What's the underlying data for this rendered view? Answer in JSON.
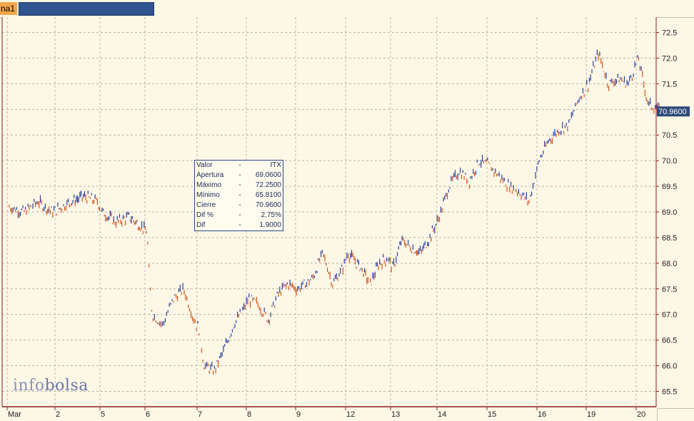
{
  "header": {
    "tab_label": "na1"
  },
  "tooltip": {
    "rows": [
      {
        "label": "Valor",
        "dash": "-",
        "value": "ITX"
      },
      {
        "label": "Apertura",
        "dash": "-",
        "value": "69.0600"
      },
      {
        "label": "Máximo",
        "dash": "-",
        "value": "72.2500"
      },
      {
        "label": "Mínimo",
        "dash": "-",
        "value": "65.8100"
      },
      {
        "label": "Cierre",
        "dash": "-",
        "value": "70.9600"
      },
      {
        "label": "Dif %",
        "dash": "-",
        "value": "2.75%"
      },
      {
        "label": "Dif",
        "dash": "-",
        "value": "1.9000"
      }
    ]
  },
  "watermark": {
    "part1": "info",
    "part2": "bolsa"
  },
  "colors": {
    "background": "#fdf7e6",
    "grid": "#b9b4a6",
    "axis": "#8b1f1f",
    "bar_up": "#2b3fa0",
    "bar_down": "#d2541c",
    "last_price_bg": "#2f4a7a"
  },
  "chart_data": {
    "type": "line",
    "ticker": "ITX",
    "x_tick_labels": [
      "Mar",
      "2",
      "5",
      "6",
      "7",
      "8",
      "9",
      "12",
      "13",
      "14",
      "15",
      "16",
      "19",
      "20"
    ],
    "y_ticks": [
      65.5,
      66.0,
      66.5,
      67.0,
      67.5,
      68.0,
      68.5,
      69.0,
      69.5,
      70.0,
      70.5,
      71.0,
      71.5,
      72.0,
      72.5
    ],
    "y_tick_labels": [
      "65.5",
      "66.0",
      "66.5",
      "67.0",
      "67.5",
      "68.0",
      "68.5",
      "69.0",
      "69.5",
      "70.0",
      "70.5",
      "71.0",
      "71.5",
      "72.0",
      "72.5"
    ],
    "ylim": [
      65.2,
      72.8
    ],
    "last_price_label": "70.9600",
    "last_price": 70.96,
    "grid": true,
    "series": [
      {
        "x": [
          0,
          0.3,
          0.6,
          0.9,
          1.0,
          1.3,
          1.6,
          1.9,
          2.0,
          2.3,
          2.6,
          2.9,
          3.0,
          3.05,
          3.1,
          3.3,
          3.5,
          3.7,
          3.9,
          4.0,
          4.1,
          4.3,
          4.5,
          4.7,
          4.9,
          5.0,
          5.2,
          5.4,
          5.6,
          5.8,
          6.0,
          6.3,
          6.5,
          6.7,
          6.9,
          7.0,
          7.3,
          7.5,
          7.7,
          7.9,
          8.0,
          8.2,
          8.4,
          8.6,
          8.8,
          9.0,
          9.2,
          9.4,
          9.6,
          9.8,
          10.0,
          10.2,
          10.4,
          10.6,
          10.8,
          11.0,
          11.2,
          11.4,
          11.6,
          11.8,
          12.0,
          12.2,
          12.4,
          12.6,
          12.8,
          13.0,
          13.2,
          13.5
        ],
        "values": [
          69.1,
          69.0,
          69.2,
          69.0,
          69.05,
          69.2,
          69.3,
          69.2,
          69.0,
          68.8,
          68.9,
          68.7,
          68.6,
          67.6,
          67.0,
          66.8,
          67.3,
          67.5,
          66.9,
          66.7,
          66.0,
          65.9,
          66.3,
          66.8,
          67.1,
          67.3,
          67.2,
          66.9,
          67.4,
          67.6,
          67.5,
          67.7,
          68.2,
          67.6,
          67.9,
          68.2,
          67.9,
          67.6,
          68.0,
          68.1,
          67.9,
          68.45,
          68.3,
          68.2,
          68.5,
          68.9,
          69.5,
          69.8,
          69.6,
          70.0,
          69.9,
          69.7,
          69.5,
          69.4,
          69.2,
          70.0,
          70.4,
          70.6,
          70.7,
          71.2,
          71.5,
          72.1,
          71.5,
          71.6,
          71.5,
          72.0,
          71.1,
          70.96
        ]
      }
    ]
  }
}
